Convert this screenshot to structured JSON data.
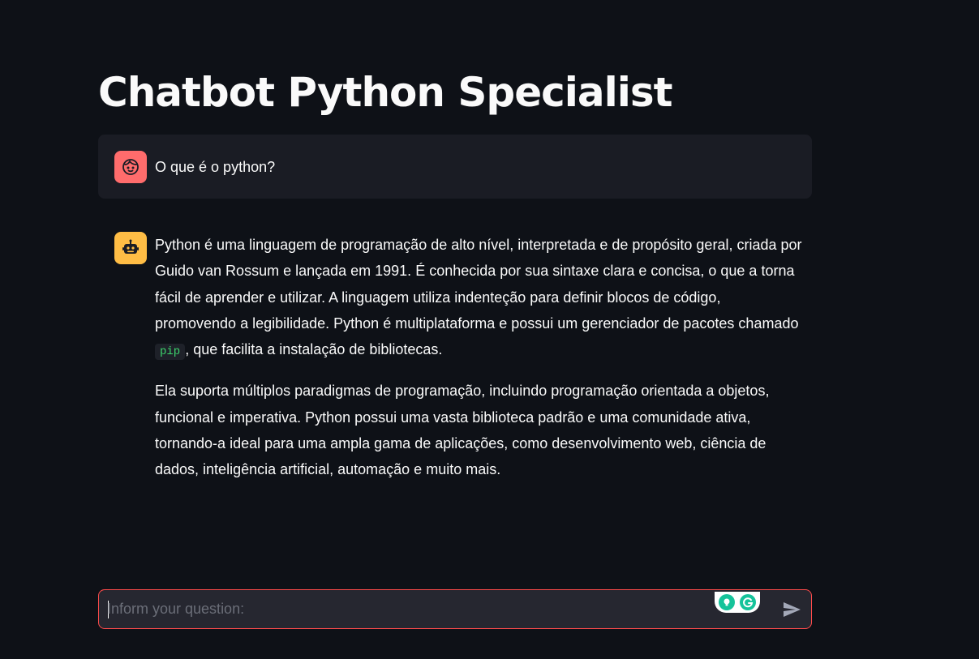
{
  "page": {
    "title": "Chatbot Python Specialist"
  },
  "colors": {
    "background": "#0e1117",
    "user_avatar": "#ff6c6c",
    "bot_avatar": "#ffbd45",
    "input_border": "#ff4b4b",
    "inline_code": "#3dd56d"
  },
  "messages": [
    {
      "role": "user",
      "avatar_icon": "user-face-icon",
      "text": "O que é o python?"
    },
    {
      "role": "assistant",
      "avatar_icon": "robot-icon",
      "para1_before": "Python é uma linguagem de programação de alto nível, interpretada e de propósito geral, criada por Guido van Rossum e lançada em 1991. É conhecida por sua sintaxe clara e concisa, o que a torna fácil de aprender e utilizar. A linguagem utiliza indenteção para definir blocos de código, promovendo a legibilidade. Python é multiplataforma e possui um gerenciador de pacotes chamado ",
      "para1_code": "pip",
      "para1_after": ", que facilita a instalação de bibliotecas.",
      "para2": "Ela suporta múltiplos paradigmas de programação, incluindo programação orientada a objetos, funcional e imperativa. Python possui uma vasta biblioteca padrão e uma comunidade ativa, tornando-a ideal para uma ampla gama de aplicações, como desenvolvimento web, ciência de dados, inteligência artificial, automação e muito mais."
    }
  ],
  "chat_input": {
    "placeholder": "Inform your question:",
    "value": "",
    "send_icon": "send-icon",
    "extension_icons": [
      "grammarly-lightbulb-icon",
      "grammarly-g-icon"
    ]
  }
}
